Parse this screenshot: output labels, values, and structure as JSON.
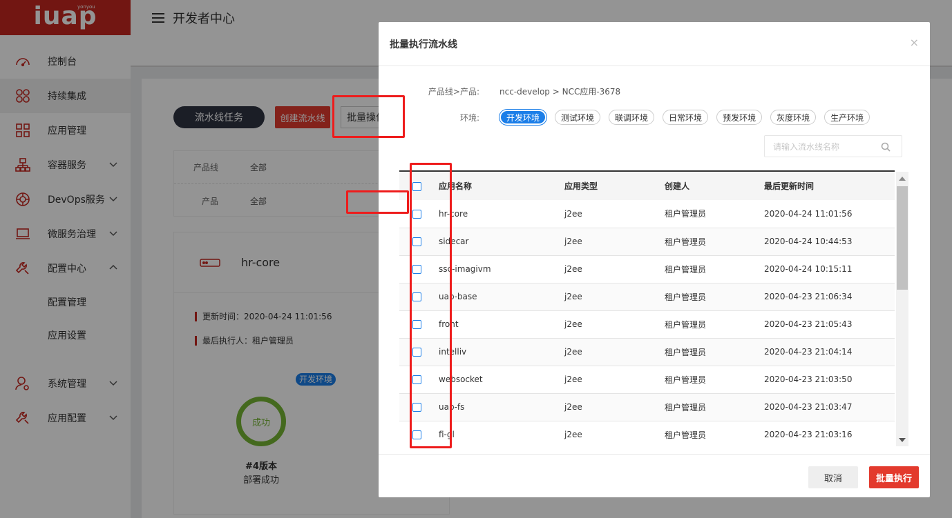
{
  "logo": {
    "text": "iuap",
    "sub": "yonyou"
  },
  "topbar": {
    "title": "开发者中心"
  },
  "sidebar": {
    "items": [
      {
        "label": "控制台",
        "icon": "dashboard-icon"
      },
      {
        "label": "持续集成",
        "icon": "integration-icon"
      },
      {
        "label": "应用管理",
        "icon": "app-grid-icon"
      },
      {
        "label": "容器服务",
        "icon": "container-icon"
      },
      {
        "label": "DevOps服务",
        "icon": "devops-icon"
      },
      {
        "label": "微服务治理",
        "icon": "laptop-icon"
      },
      {
        "label": "配置中心",
        "icon": "wrench-icon"
      },
      {
        "label": "系统管理",
        "icon": "user-gear-icon"
      },
      {
        "label": "应用配置",
        "icon": "wrench-icon"
      }
    ],
    "sub_items": [
      "配置管理",
      "应用设置"
    ]
  },
  "page": {
    "pipeline_task_button": "流水线任务",
    "create_pipeline_button": "创建流水线",
    "batch_ops_button": "批量操作",
    "filters": [
      {
        "key": "产品线",
        "value": "全部"
      },
      {
        "key": "产品",
        "value": "全部"
      }
    ],
    "card": {
      "name": "hr-core",
      "update_time": "更新时间：2020-04-24 11:01:56",
      "last_executor": "最后执行人：租户管理员",
      "env_tag": "开发环境",
      "status": "成功",
      "version": "#4版本",
      "deploy_status": "部署成功"
    }
  },
  "modal": {
    "title": "批量执行流水线",
    "close": "×",
    "product_label": "产品线>产品:",
    "product_value": "ncc-develop > NCC应用-3678",
    "env_label": "环境:",
    "envs": [
      "开发环境",
      "测试环境",
      "联调环境",
      "日常环境",
      "预发环境",
      "灰度环境",
      "生产环境"
    ],
    "active_env": "开发环境",
    "search_placeholder": "请输入流水线名称",
    "columns": [
      "应用名称",
      "应用类型",
      "创建人",
      "最后更新时间"
    ],
    "rows": [
      {
        "name": "hr-core",
        "type": "j2ee",
        "creator": "租户管理员",
        "updated": "2020-04-24 11:01:56"
      },
      {
        "name": "sidecar",
        "type": "j2ee",
        "creator": "租户管理员",
        "updated": "2020-04-24 10:44:53"
      },
      {
        "name": "ssc-imagivm",
        "type": "j2ee",
        "creator": "租户管理员",
        "updated": "2020-04-24 10:15:11"
      },
      {
        "name": "uap-base",
        "type": "j2ee",
        "creator": "租户管理员",
        "updated": "2020-04-23 21:06:34"
      },
      {
        "name": "front",
        "type": "j2ee",
        "creator": "租户管理员",
        "updated": "2020-04-23 21:05:43"
      },
      {
        "name": "intelliv",
        "type": "j2ee",
        "creator": "租户管理员",
        "updated": "2020-04-23 21:04:14"
      },
      {
        "name": "websocket",
        "type": "j2ee",
        "creator": "租户管理员",
        "updated": "2020-04-23 21:03:50"
      },
      {
        "name": "uap-fs",
        "type": "j2ee",
        "creator": "租户管理员",
        "updated": "2020-04-23 21:03:47"
      },
      {
        "name": "fi-gl",
        "type": "j2ee",
        "creator": "租户管理员",
        "updated": "2020-04-23 21:03:16"
      }
    ],
    "cancel_button": "取消",
    "execute_button": "批量执行"
  },
  "colors": {
    "brand_red": "#c5271f",
    "accent_blue": "#1b7ee8",
    "success_green": "#76b534",
    "annotation_red": "#ee1c1c"
  }
}
